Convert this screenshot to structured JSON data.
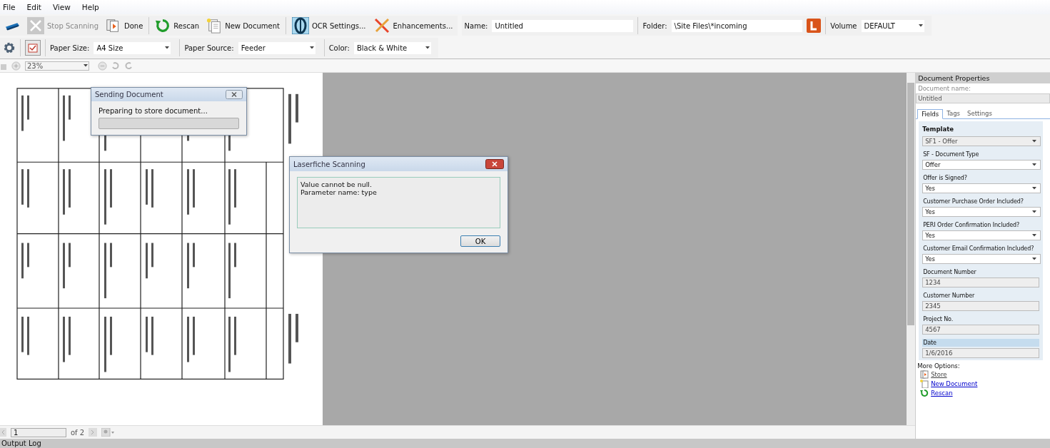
{
  "menu": [
    "File",
    "Edit",
    "View",
    "Help"
  ],
  "toolbar": [
    {
      "label": "Stop Scanning",
      "disabled": true
    },
    {
      "label": "Done",
      "disabled": false
    },
    {
      "label": "Rescan",
      "disabled": false
    },
    {
      "label": "New Document",
      "disabled": false
    },
    {
      "label": "OCR Settings...",
      "disabled": false
    },
    {
      "label": "Enhancements...",
      "disabled": false
    }
  ],
  "doc_fields": [
    {
      "label": "Name:",
      "value": "Untitled"
    },
    {
      "label": "Folder:",
      "value": "\\Site Files\\*incoming"
    }
  ],
  "volume": {
    "label": "Volume",
    "value": "DEFAULT"
  },
  "scan_options": [
    {
      "label": "Paper Size:",
      "value": "A4 Size"
    },
    {
      "label": "Paper Source:",
      "value": "Feeder"
    },
    {
      "label": "Color:",
      "value": "Black & White"
    }
  ],
  "zoom": {
    "value": "23%"
  },
  "pager": {
    "value": "1",
    "total": "of 2"
  },
  "output_log": "Output Log",
  "properties": {
    "title": "Document Properties",
    "name_label": "Document name:",
    "name_value": "Untitled",
    "tabs": [
      {
        "label": "Fields",
        "selected": true
      },
      {
        "label": "Tags",
        "selected": false
      },
      {
        "label": "Settings",
        "selected": false
      }
    ],
    "template_label": "Template",
    "template_value": "SF1 - Offer",
    "fields": [
      {
        "kind": "select",
        "label": "SF - Document Type",
        "value": "Offer",
        "selected": false
      },
      {
        "kind": "select",
        "label": "Offer is Signed?",
        "value": "Yes",
        "selected": false
      },
      {
        "kind": "select",
        "label": "Customer Purchase Order Included?",
        "value": "Yes",
        "selected": false
      },
      {
        "kind": "select",
        "label": "PERI Order Confirmation Included?",
        "value": "Yes",
        "selected": false
      },
      {
        "kind": "select",
        "label": "Customer Email Confirmation Included?",
        "value": "Yes",
        "selected": false
      },
      {
        "kind": "text",
        "label": "Document Number",
        "value": "1234",
        "selected": false
      },
      {
        "kind": "text",
        "label": "Customer Number",
        "value": "2345",
        "selected": false
      },
      {
        "kind": "text",
        "label": "Project No.",
        "value": "4567",
        "selected": false
      },
      {
        "kind": "text",
        "label": "Date",
        "value": "1/6/2016",
        "selected": true
      }
    ],
    "more_label": "More Options:",
    "links": [
      {
        "label": "Store",
        "disabled": true
      },
      {
        "label": "New Document",
        "disabled": false
      },
      {
        "label": "Rescan",
        "disabled": false
      }
    ]
  },
  "sending_dialog": {
    "title": "Sending Document",
    "message": "Preparing to store document...",
    "level": 0
  },
  "error_dialog": {
    "title": "Laserfiche Scanning",
    "message": "Value cannot be null.\nParameter name: type",
    "button": "OK"
  }
}
